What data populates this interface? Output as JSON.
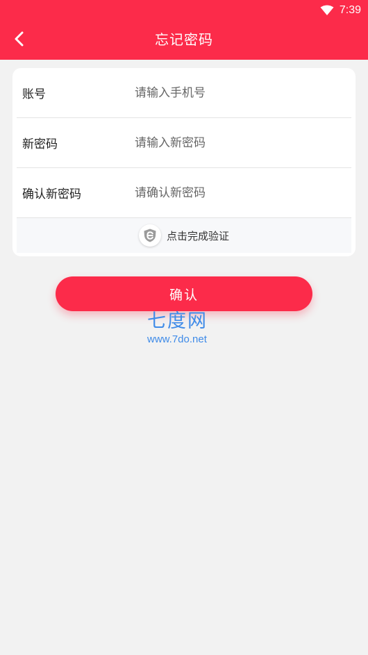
{
  "status_bar": {
    "time": "7:39"
  },
  "header": {
    "title": "忘记密码"
  },
  "form": {
    "rows": [
      {
        "label": "账号",
        "placeholder": "请输入手机号"
      },
      {
        "label": "新密码",
        "placeholder": "请输入新密码"
      },
      {
        "label": "确认新密码",
        "placeholder": "请确认新密码"
      }
    ],
    "verify_label": "点击完成验证"
  },
  "confirm_label": "确认",
  "watermark": {
    "title": "七度网",
    "url": "www.7do.net"
  },
  "colors": {
    "brand": "#fc2b4a",
    "background": "#f2f2f2",
    "watermark": "#3f8be8"
  }
}
